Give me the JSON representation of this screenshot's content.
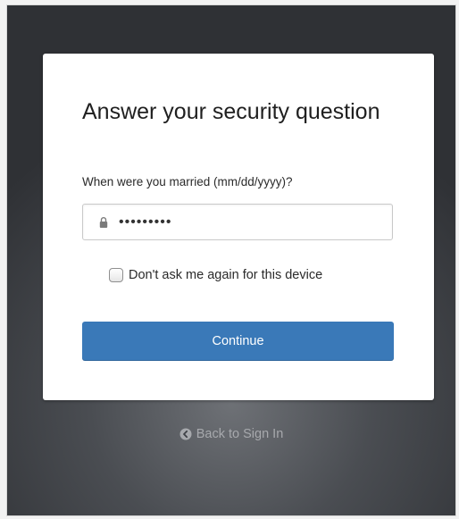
{
  "card": {
    "title": "Answer your security question",
    "question": "When were you married (mm/dd/yyyy)?",
    "answer_value": "•••••••••",
    "remember_label": "Don't ask me again for this device",
    "continue_label": "Continue"
  },
  "footer": {
    "back_label": "Back to Sign In"
  },
  "icons": {
    "lock": "lock-icon",
    "back": "arrow-left-circle-icon"
  },
  "colors": {
    "primary": "#3a79b8",
    "link": "#a7a9ad"
  }
}
